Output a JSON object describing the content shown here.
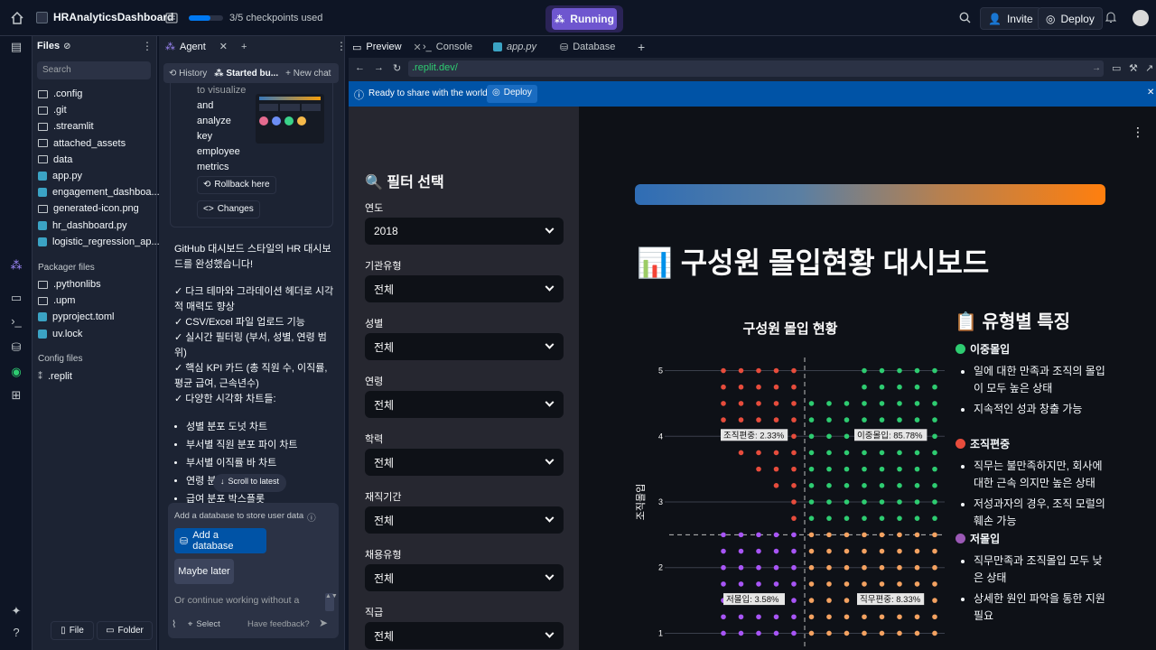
{
  "app": {
    "project_name": "HRAnalyticsDashboard",
    "checkpoints": "3/5 checkpoints used",
    "status": "Running",
    "invite": "Invite",
    "deploy": "Deploy"
  },
  "files": {
    "title": "Files",
    "search_placeholder": "Search",
    "items": [
      ".config",
      ".git",
      ".streamlit",
      "attached_assets",
      "data",
      "app.py",
      "engagement_dashboa...",
      "generated-icon.png",
      "hr_dashboard.py",
      "logistic_regression_ap..."
    ],
    "packager_label": "Packager files",
    "packager_items": [
      ".pythonlibs",
      ".upm",
      "pyproject.toml",
      "uv.lock"
    ],
    "config_label": "Config files",
    "config_items": [
      ".replit"
    ],
    "new_file": "File",
    "new_folder": "Folder"
  },
  "agent": {
    "tab": "Agent",
    "history": "History",
    "started": "Started bu...",
    "new_chat": "New chat",
    "snippet_lines": [
      "to visualize",
      "and",
      "analyze",
      "key",
      "employee",
      "metrics"
    ],
    "rollback": "Rollback here",
    "changes": "Changes",
    "message_intro": "GitHub 대시보드 스타일의 HR 대시보드를 완성했습니다!",
    "checks": [
      "✓ 다크 테마와 그라데이션 헤더로 시각적 매력도 향상",
      "✓ CSV/Excel 파일 업로드 기능",
      "✓ 실시간 필터링 (부서, 성별, 연령 범위)",
      "✓ 핵심 KPI 카드 (총 직원 수, 이직률, 평균 급여, 근속년수)",
      "✓ 다양한 시각화 차트들:"
    ],
    "bullets": [
      "성별 분포 도넛 차트",
      "부서별 직원 분포 파이 차트",
      "부서별 이직률 바 차트",
      "연령 분",
      "급여 분포 박스플롯"
    ],
    "scroll_latest": "Scroll to latest",
    "db_prompt": "Add a database to store user data",
    "add_db": "Add a database",
    "maybe_later": "Maybe later",
    "continue_placeholder": "Or continue working without a",
    "select": "Select",
    "feedback": "Have feedback?"
  },
  "preview": {
    "tabs": [
      "Preview",
      "Console",
      "app.py",
      "Database"
    ],
    "url": ".replit.dev/",
    "banner_text": "Ready to share with the world?",
    "banner_deploy": "Deploy"
  },
  "filters": {
    "heading": "🔍 필터 선택",
    "fields": [
      {
        "label": "연도",
        "value": "2018"
      },
      {
        "label": "기관유형",
        "value": "전체"
      },
      {
        "label": "성별",
        "value": "전체"
      },
      {
        "label": "연령",
        "value": "전체"
      },
      {
        "label": "학력",
        "value": "전체"
      },
      {
        "label": "재직기간",
        "value": "전체"
      },
      {
        "label": "채용유형",
        "value": "전체"
      },
      {
        "label": "직급",
        "value": "전체"
      }
    ]
  },
  "dashboard": {
    "title": "📊 구성원 몰입현황 대시보드",
    "chart_title": "구성원 몰입 현황",
    "ylabel": "조직몰입",
    "types_title": "📋 유형별 특징",
    "types": [
      {
        "name": "이중몰입",
        "color": "#2ecc71",
        "points": [
          "일에 대한 만족과 조직의 몰입이 모두 높은 상태",
          "지속적인 성과 창출 가능"
        ]
      },
      {
        "name": "조직편중",
        "color": "#e74c3c",
        "points": [
          "직무는 불만족하지만, 회사에 대한 근속 의지만 높은 상태",
          "저성과자의 경우, 조직 모럴의 훼손 가능"
        ]
      },
      {
        "name": "저몰입",
        "color": "#9b59b6",
        "points": [
          "직무만족과 조직몰입 모두 낮은 상태",
          "상세한 원인 파악을 통한 지원 필요"
        ]
      }
    ]
  },
  "chart_data": {
    "type": "scatter",
    "title": "구성원 몰입 현황",
    "ylabel": "조직몰입",
    "yticks": [
      1,
      2,
      3,
      4,
      5
    ],
    "ylim": [
      0.8,
      5.2
    ],
    "annotations": [
      {
        "text": "조직편중: 2.33%",
        "color": "#e74c3c"
      },
      {
        "text": "이중몰입: 85.78%",
        "color": "#2ecc71"
      },
      {
        "text": "저몰입: 3.58%",
        "color": "#9b59b6"
      },
      {
        "text": "직무편중: 8.33%",
        "color": "#f39c6b"
      }
    ],
    "divider_y": 2.5,
    "colors": {
      "double": "#2ecc71",
      "org": "#e74c3c",
      "low": "#a855f7",
      "job": "#f4a261"
    }
  }
}
